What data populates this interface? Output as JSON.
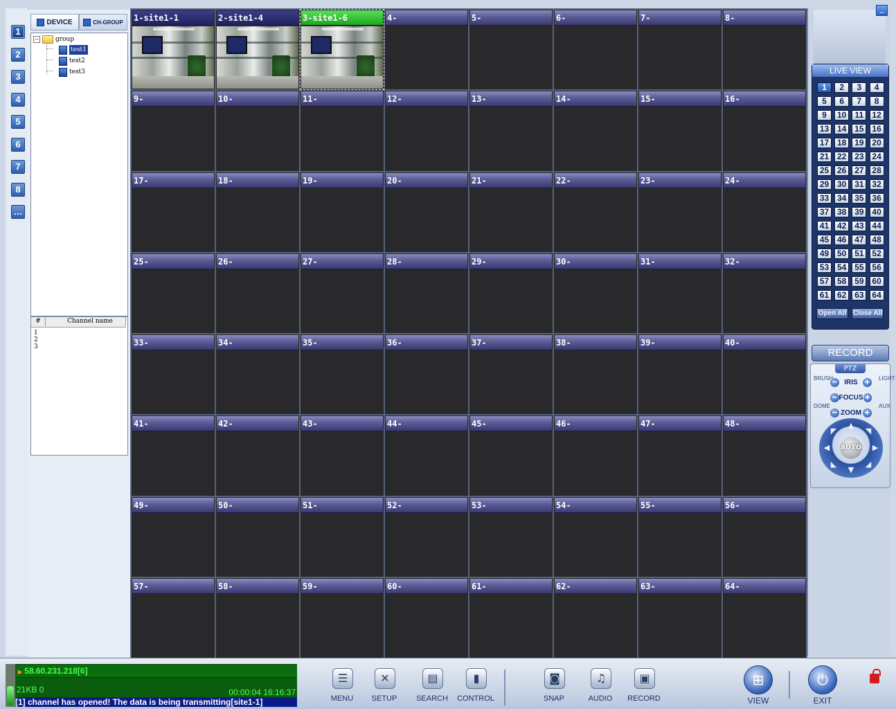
{
  "left_panel": {
    "tabs": [
      {
        "label": "DEVICE",
        "active": true
      },
      {
        "label": "CH-GROUP",
        "active": false
      }
    ],
    "tree": {
      "group": "group",
      "devices": [
        "test1",
        "test2",
        "test3"
      ],
      "selected": "test1"
    },
    "channel_list": {
      "columns": [
        "#",
        "Channel name"
      ],
      "rows": [
        "1",
        "2",
        "3"
      ]
    }
  },
  "page_buttons": [
    "1",
    "2",
    "3",
    "4",
    "5",
    "6",
    "7",
    "8",
    "…"
  ],
  "grid": {
    "tiles": [
      "1-site1-1",
      "2-site1-4",
      "3-site1-6",
      "4-",
      "5-",
      "6-",
      "7-",
      "8-",
      "9-",
      "10-",
      "11-",
      "12-",
      "13-",
      "14-",
      "15-",
      "16-",
      "17-",
      "18-",
      "19-",
      "20-",
      "21-",
      "22-",
      "23-",
      "24-",
      "25-",
      "26-",
      "27-",
      "28-",
      "29-",
      "30-",
      "31-",
      "32-",
      "33-",
      "34-",
      "35-",
      "36-",
      "37-",
      "38-",
      "39-",
      "40-",
      "41-",
      "42-",
      "43-",
      "44-",
      "45-",
      "46-",
      "47-",
      "48-",
      "49-",
      "50-",
      "51-",
      "52-",
      "53-",
      "54-",
      "55-",
      "56-",
      "57-",
      "58-",
      "59-",
      "60-",
      "61-",
      "62-",
      "63-",
      "64-"
    ],
    "live_tiles": [
      1,
      2,
      3
    ],
    "selected_tile": 3
  },
  "right_panel": {
    "live_view_title": "LIVE VIEW",
    "active_channel": 1,
    "open_all": "Open All",
    "close_all": "Close All",
    "record": "RECORD",
    "ptz": {
      "title": "PTZ",
      "controls": [
        "IRIS",
        "FOCUS",
        "ZOOM"
      ],
      "left_labels": [
        "BRUSH",
        "DOME"
      ],
      "right_labels": [
        "LIGHT",
        "AUX"
      ],
      "auto": "AUTO",
      "minus": "−",
      "plus": "+"
    }
  },
  "status": {
    "ip": "58.60.231.218[6]",
    "kb": "21KB 0",
    "time": "00:00:04 16:16:37",
    "message": "[1] channel has opened! The data is being transmitting[site1-1]"
  },
  "toolbar": {
    "buttons": [
      {
        "label": "MENU",
        "icon": "menu-icon"
      },
      {
        "label": "SETUP",
        "icon": "setup-icon"
      },
      {
        "label": "SEARCH",
        "icon": "search-icon"
      },
      {
        "label": "CONTROL",
        "icon": "control-icon"
      },
      {
        "label": "SNAP",
        "icon": "snap-icon"
      },
      {
        "label": "AUDIO",
        "icon": "audio-icon"
      },
      {
        "label": "RECORD",
        "icon": "record-icon"
      }
    ],
    "view": "VIEW",
    "exit": "EXIT"
  },
  "colors": {
    "tile_bar": "#5a5a95",
    "selected_tile_bar": "#1fa51f",
    "status_green": "#46ff46",
    "message_bar": "#0a1a8a"
  }
}
